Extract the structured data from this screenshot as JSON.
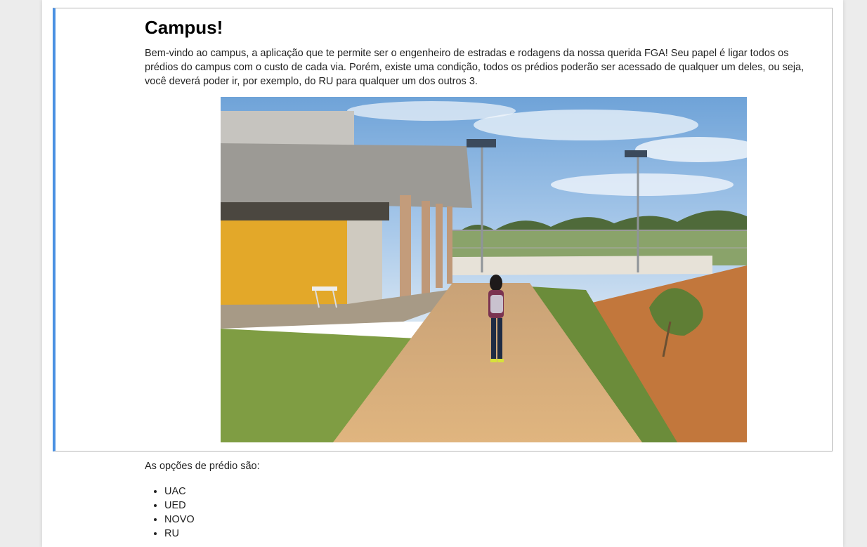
{
  "card": {
    "title": "Campus!",
    "intro": "Bem-vindo ao campus, a aplicação que te permite ser o engenheiro de estradas e rodagens da nossa querida FGA! Seu papel é ligar todos os prédios do campus com o custo de cada via. Porém, existe uma condição, todos os prédios poderão ser acessado de qualquer um deles, ou seja, você deverá poder ir, por exemplo, do RU para qualquer um dos outros 3."
  },
  "options": {
    "label": "As opções de prédio são:",
    "items": [
      "UAC",
      "UED",
      "NOVO",
      "RU"
    ]
  },
  "colors": {
    "accent": "#4a90e2",
    "card_border": "#b7b7b7",
    "page_background": "#ececec"
  }
}
